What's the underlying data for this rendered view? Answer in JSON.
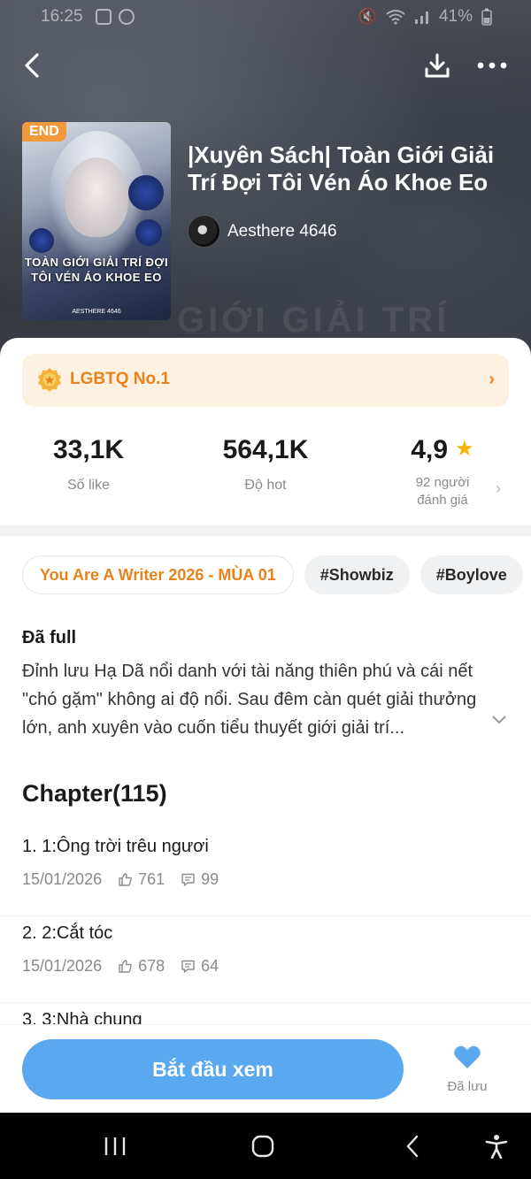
{
  "status_bar": {
    "time": "16:25",
    "battery": "41%"
  },
  "header": {
    "end_badge": "END",
    "cover_title": "TOÀN GIỚI GIẢI TRÍ ĐỢI TÔI VÉN ÁO KHOE EO",
    "cover_author": "AESTHERE 4646",
    "title": "|Xuyên Sách| Toàn Giới Giải Trí Đợi Tôi Vén Áo Khoe Eo",
    "author": "Aesthere 4646",
    "hero_ghost": "GIỚI GIẢI TRÍ"
  },
  "rank": {
    "label": "LGBTQ No.1"
  },
  "stats": {
    "likes": {
      "value": "33,1K",
      "label": "Số like"
    },
    "hot": {
      "value": "564,1K",
      "label": "Độ hot"
    },
    "rating": {
      "value": "4,9",
      "label_line1": "92 người",
      "label_line2": "đánh giá"
    }
  },
  "tags": [
    "You Are A Writer 2026 - MÙA 01",
    "#Showbiz",
    "#Boylove"
  ],
  "synopsis": {
    "status": "Đã full",
    "text": "Đỉnh lưu Hạ Dã nổi danh với tài năng thiên phú và cái nết \"chó gặm\" không ai độ nổi. Sau đêm càn quét giải thưởng lớn, anh xuyên vào cuốn tiểu thuyết giới giải trí..."
  },
  "chapters": {
    "header": "Chapter(115)",
    "items": [
      {
        "title": "1. 1:Ông trời trêu ngươi",
        "date": "15/01/2026",
        "likes": "761",
        "comments": "99"
      },
      {
        "title": "2. 2:Cắt tóc",
        "date": "15/01/2026",
        "likes": "678",
        "comments": "64"
      },
      {
        "title": "3. 3:Nhà chung",
        "date": "",
        "likes": "",
        "comments": ""
      }
    ]
  },
  "actions": {
    "start_label": "Bắt đầu xem",
    "saved_label": "Đã lưu"
  },
  "colors": {
    "accent_blue": "#5aa8f0",
    "accent_orange": "#e8821a",
    "star": "#f5b400"
  }
}
